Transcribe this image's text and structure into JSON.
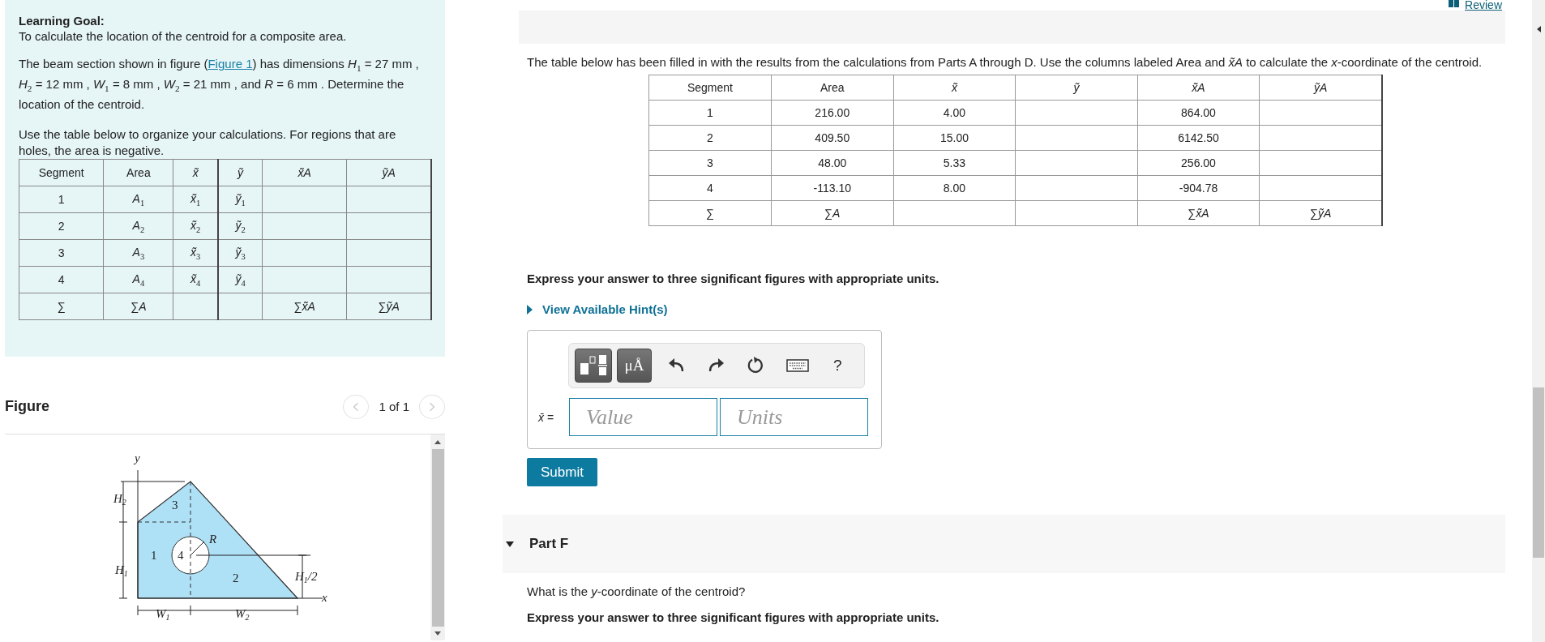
{
  "goal": {
    "heading": "Learning Goal:",
    "text": "To calculate the location of the centroid for a composite area.",
    "statement_before": "The beam section shown in figure (",
    "figure_link": "Figure 1",
    "statement_after": ") has dimensions *H*$_{1}$ = 27 mm , *H*$_{2}$ = 12 mm , *W*$_{1}$ = 8 mm , *W*$_{2}$ = 21 mm , and *R* = 6 mm . Determine the location of the centroid.",
    "instructions": "Use the table below to organize your calculations. For regions that are holes, the area is negative.",
    "table": {
      "columns": [
        "Segment",
        "Area",
        "*x̃*",
        "*ỹ*",
        "*x̃A*",
        "*ỹA*"
      ],
      "rows": [
        [
          "1",
          "*A*$_{1}$",
          "*x̃*$_{1}$",
          "*ỹ*$_{1}$",
          "",
          ""
        ],
        [
          "2",
          "*A*$_{2}$",
          "*x̃*$_{2}$",
          "*ỹ*$_{2}$",
          "",
          ""
        ],
        [
          "3",
          "*A*$_{3}$",
          "*x̃*$_{3}$",
          "*ỹ*$_{3}$",
          "",
          ""
        ],
        [
          "4",
          "*A*$_{4}$",
          "*x̃*$_{4}$",
          "*ỹ*$_{4}$",
          "",
          ""
        ],
        [
          "∑",
          "∑*A*",
          "",
          "",
          "∑*x̃A*",
          "∑*ỹA*"
        ]
      ]
    }
  },
  "figure": {
    "title": "Figure",
    "pager": "1 of 1",
    "labels": [
      {
        "kind": "variable",
        "text": "y"
      },
      {
        "kind": "variable",
        "text": "H",
        "sub": "2"
      },
      {
        "kind": "number",
        "text": "3"
      },
      {
        "kind": "variable",
        "text": "R"
      },
      {
        "kind": "number",
        "text": "1"
      },
      {
        "kind": "number",
        "text": "4"
      },
      {
        "kind": "variable",
        "text": "H",
        "sub": "1"
      },
      {
        "kind": "number",
        "text": "2"
      },
      {
        "kind": "variable",
        "text": "H",
        "sub": "1",
        "suffix": "/2"
      },
      {
        "kind": "variable",
        "text": "x"
      },
      {
        "kind": "variable",
        "text": "W",
        "sub": "1"
      },
      {
        "kind": "variable",
        "text": "W",
        "sub": "2"
      }
    ]
  },
  "part_e": {
    "review_link": "Review",
    "intro": "The table below has been filled in with the results from the calculations from Parts A through D. Use the columns labeled Area and *x̃A* to calculate the *x*-coordinate of the centroid.",
    "table": {
      "columns": [
        "Segment",
        "Area",
        "*x̃*",
        "*ỹ*",
        "*x̃A*",
        "*ỹA*"
      ],
      "rows": [
        [
          "1",
          "216.00",
          "4.00",
          "",
          "864.00",
          ""
        ],
        [
          "2",
          "409.50",
          "15.00",
          "",
          "6142.50",
          ""
        ],
        [
          "3",
          "48.00",
          "5.33",
          "",
          "256.00",
          ""
        ],
        [
          "4",
          "-113.10",
          "8.00",
          "",
          "-904.78",
          ""
        ],
        [
          "∑",
          "∑*A*",
          "",
          "",
          "∑*x̃A*",
          "∑*ỹA*"
        ]
      ]
    },
    "instruction": "Express your answer to three significant figures with appropriate units.",
    "hint": {
      "label": "View Available Hint(s)",
      "expanded": false
    },
    "toolbar": {
      "units_button": "μÅ",
      "help_button": "?"
    },
    "answer_label": "*x̄* =",
    "value_placeholder": "Value",
    "units_placeholder": "Units",
    "submit": "Submit"
  },
  "part_f": {
    "title": "Part F",
    "expanded": true,
    "question": "What is the *y*-coordinate of the centroid?",
    "instruction": "Express your answer to three significant figures with appropriate units."
  }
}
